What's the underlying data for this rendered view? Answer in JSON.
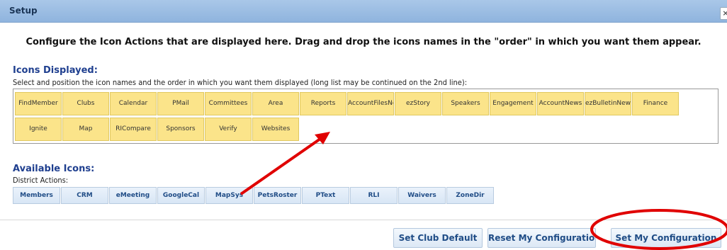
{
  "window": {
    "title": "Setup",
    "close_glyph": "×"
  },
  "instructions": "Configure the Icon Actions that are displayed here. Drag and drop the icons names in the \"order\" in which you want them appear.",
  "icons_displayed": {
    "heading": "Icons Displayed:",
    "subtext": "Select and position the icon names and the order in which you want them displayed (long list may be continued on the 2nd line):",
    "row1": [
      "FindMember",
      "Clubs",
      "Calendar",
      "PMail",
      "Committees",
      "Area",
      "Reports",
      "AccountFilesNew",
      "ezStory",
      "Speakers",
      "Engagement",
      "AccountNews",
      "ezBulletinNew",
      "Finance"
    ],
    "row2": [
      "Ignite",
      "Map",
      "RICompare",
      "Sponsors",
      "Verify",
      "Websites"
    ]
  },
  "available_icons": {
    "heading": "Available Icons:",
    "group_label": "District Actions:",
    "items": [
      "Members",
      "CRM",
      "eMeeting",
      "GoogleCal",
      "MapSys",
      "PetsRoster",
      "PText",
      "RLI",
      "Waivers",
      "ZoneDir"
    ]
  },
  "footer": {
    "set_club_default": "Set Club Default",
    "reset_my_configuration": "Reset My Configuration",
    "set_my_configuration": "Set My Configuration"
  },
  "colors": {
    "annotation": "#e00000",
    "tile_yellow": "#fbe48a",
    "heading_blue": "#1f3f8f"
  },
  "icons": {
    "close": "close-icon"
  }
}
